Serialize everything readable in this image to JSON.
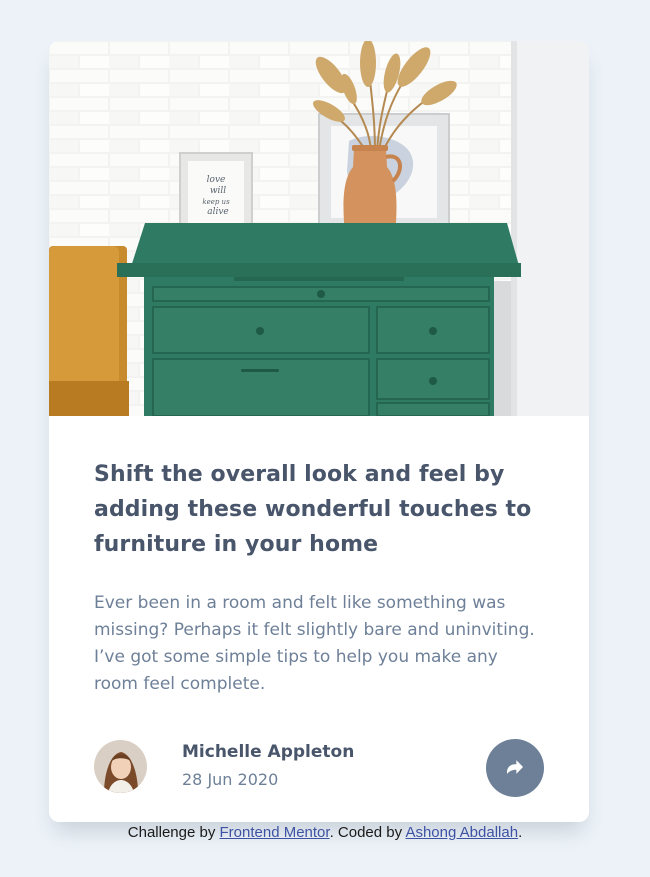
{
  "article": {
    "title": "Shift the overall look and feel by adding these wonderful touches to furniture in your home",
    "description": "Ever been in a room and felt like something was missing? Perhaps it felt slightly bare and uninviting. I’ve got some simple tips to help you make any room feel complete.",
    "hero_frame_text": "love will keep us alive"
  },
  "author": {
    "name": "Michelle Appleton",
    "date": "28 Jun 2020"
  },
  "share": {
    "icon": "share-icon"
  },
  "attribution": {
    "prefix": "Challenge by ",
    "challenge_link": "Frontend Mentor",
    "middle": ". Coded by ",
    "author_link": "Ashong Abdallah",
    "suffix": "."
  },
  "colors": {
    "background": "#ecf2f8",
    "card": "#ffffff",
    "heading": "#48556a",
    "body_text": "#6e8098",
    "share_button": "#6e8098",
    "link": "#3e52a3",
    "drawer_green": "#2f7a62"
  }
}
